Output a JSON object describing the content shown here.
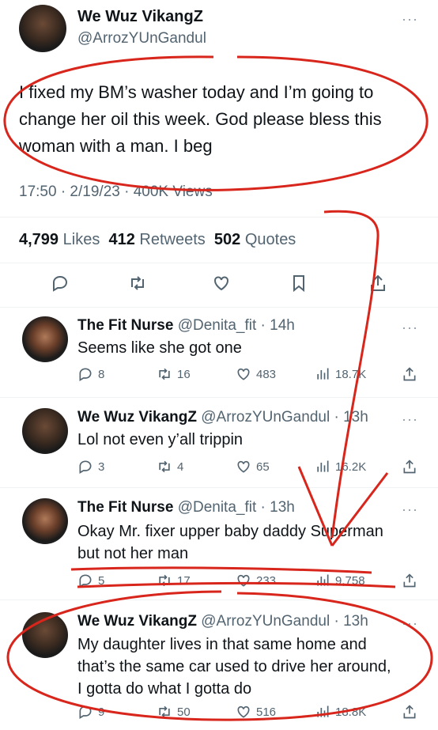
{
  "main_tweet": {
    "author_name": "We Wuz VikangZ",
    "author_handle": "@ArrozYUnGandul",
    "text_line1": "I fixed my BM’s washer today and I’m going to",
    "text_line2": "change her oil this week. God please bless this",
    "text_line3": "woman with a man. I beg",
    "meta": "17:50 · 2/19/23 · 400K Views",
    "likes_count": "4,799",
    "likes_label": "Likes",
    "retweets_count": "412",
    "retweets_label": "Retweets",
    "quotes_count": "502",
    "quotes_label": "Quotes"
  },
  "replies": [
    {
      "name": "The Fit Nurse",
      "handle": "@Denita_fit",
      "time": "· 14h",
      "line1": "Seems like she got one",
      "line2": "",
      "line3": "",
      "replies": "8",
      "retweets": "16",
      "likes": "483",
      "views": "18.7K"
    },
    {
      "name": "We Wuz VikangZ",
      "handle": "@ArrozYUnGandul",
      "time": "· 13h",
      "line1": "Lol not even y’all trippin",
      "line2": "",
      "line3": "",
      "replies": "3",
      "retweets": "4",
      "likes": "65",
      "views": "16.2K"
    },
    {
      "name": "The Fit Nurse",
      "handle": "@Denita_fit",
      "time": "· 13h",
      "line1": "Okay Mr. fixer upper baby daddy Superman",
      "line2": "but not her man",
      "line3": "",
      "replies": "5",
      "retweets": "17",
      "likes": "233",
      "views": "9,758"
    },
    {
      "name": "We Wuz VikangZ",
      "handle": "@ArrozYUnGandul",
      "time": "· 13h",
      "line1": "My daughter lives in that same home and",
      "line2": "that’s the same car used to drive her around,",
      "line3": "I gotta do what I gotta do",
      "replies": "9",
      "retweets": "50",
      "likes": "516",
      "views": "18.8K"
    }
  ],
  "colors": {
    "annotation_red": "#d8261c",
    "secondary_text": "#536471"
  },
  "icons": [
    "reply-icon",
    "retweet-icon",
    "like-icon",
    "bookmark-icon",
    "share-icon",
    "views-icon",
    "more-icon"
  ]
}
